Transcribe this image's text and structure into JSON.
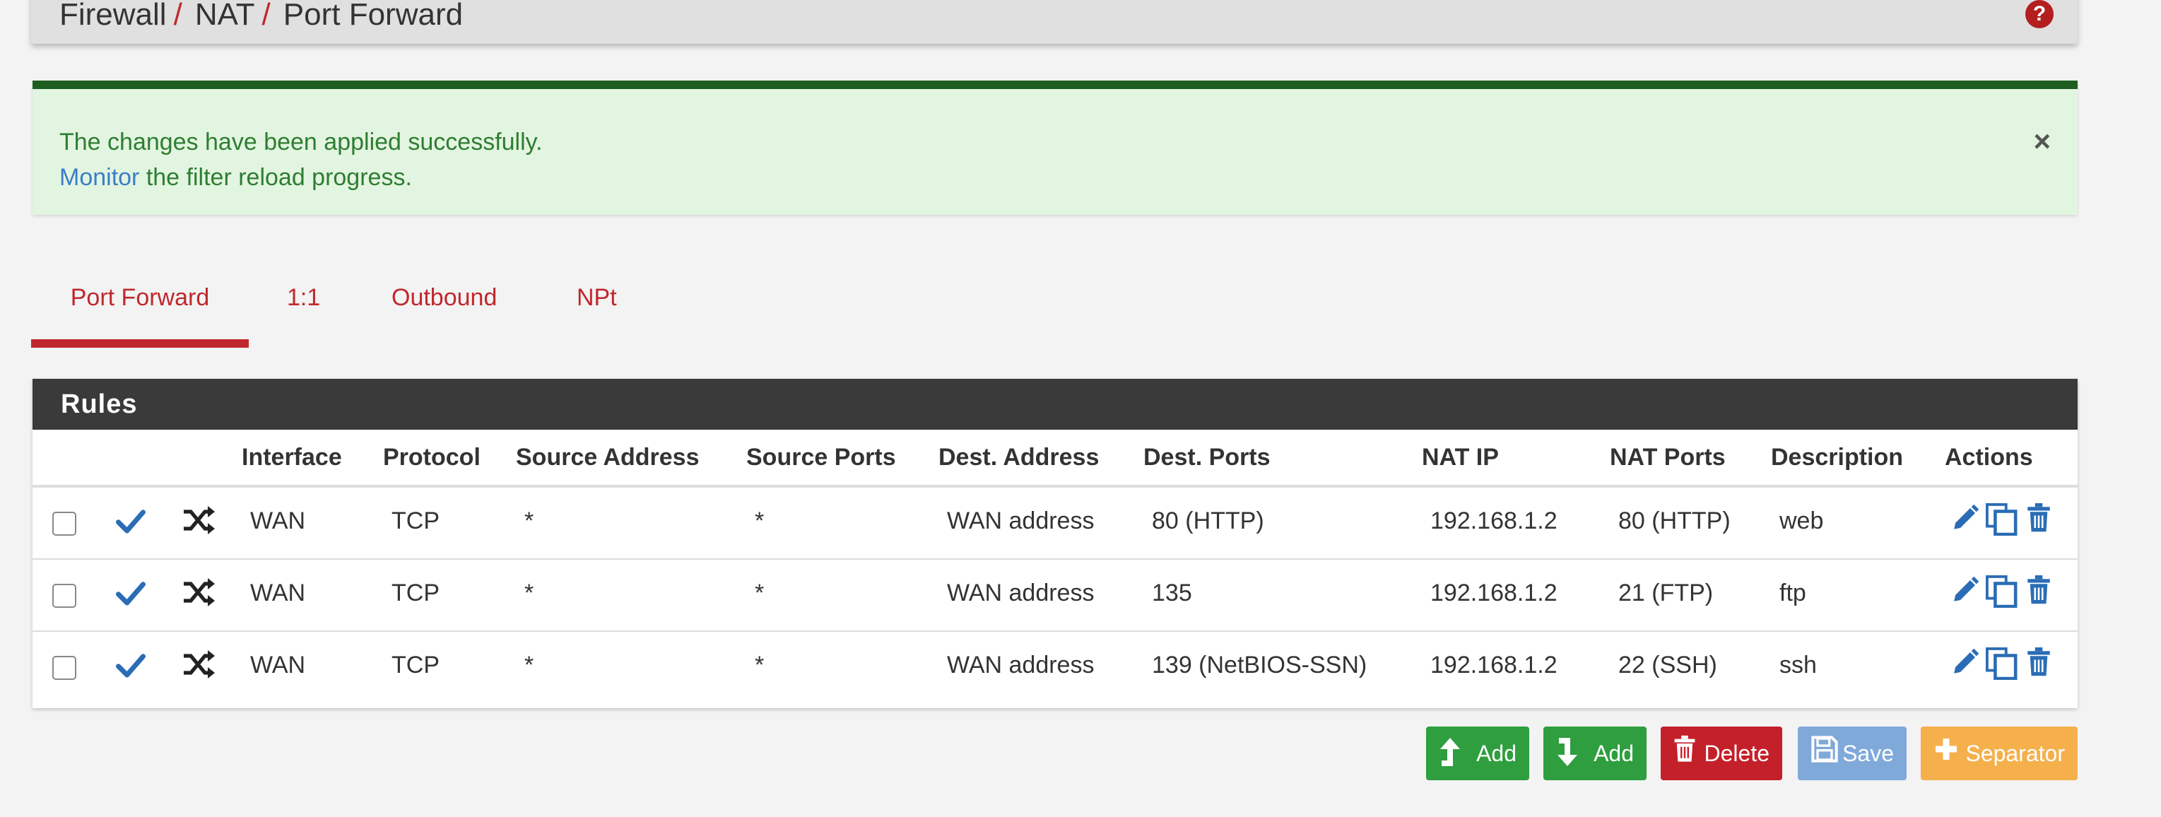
{
  "header": {
    "breadcrumb": [
      "Firewall",
      "NAT",
      "Port Forward"
    ],
    "separator": "/",
    "help_icon": "question-circle-icon"
  },
  "alert": {
    "message": "The changes have been applied successfully.",
    "link_text": "Monitor",
    "link_suffix": " the filter reload progress.",
    "close": "×"
  },
  "tabs": [
    {
      "label": "Port Forward",
      "active": true
    },
    {
      "label": "1:1",
      "active": false
    },
    {
      "label": "Outbound",
      "active": false
    },
    {
      "label": "NPt",
      "active": false
    }
  ],
  "panel": {
    "title": "Rules",
    "columns": [
      "Interface",
      "Protocol",
      "Source Address",
      "Source Ports",
      "Dest. Address",
      "Dest. Ports",
      "NAT IP",
      "NAT Ports",
      "Description",
      "Actions"
    ],
    "rows": [
      {
        "interface": "WAN",
        "protocol": "TCP",
        "src_addr": "*",
        "src_ports": "*",
        "dst_addr": "WAN address",
        "dst_ports": "80 (HTTP)",
        "nat_ip": "192.168.1.2",
        "nat_ports": "80 (HTTP)",
        "description": "web"
      },
      {
        "interface": "WAN",
        "protocol": "TCP",
        "src_addr": "*",
        "src_ports": "*",
        "dst_addr": "WAN address",
        "dst_ports": "135",
        "nat_ip": "192.168.1.2",
        "nat_ports": "21 (FTP)",
        "description": "ftp"
      },
      {
        "interface": "WAN",
        "protocol": "TCP",
        "src_addr": "*",
        "src_ports": "*",
        "dst_addr": "WAN address",
        "dst_ports": "139 (NetBIOS-SSN)",
        "nat_ip": "192.168.1.2",
        "nat_ports": "22 (SSH)",
        "description": "ssh"
      }
    ]
  },
  "buttons": {
    "add_top": "Add",
    "add_bottom": "Add",
    "delete": "Delete",
    "save": "Save",
    "separator": "Separator"
  },
  "colors": {
    "accent_red": "#c0282d",
    "success_green": "#2e9e3e",
    "alert_bg": "#e2f5e0",
    "link_blue": "#3b7ec9",
    "icon_blue": "#2a6cb5"
  }
}
